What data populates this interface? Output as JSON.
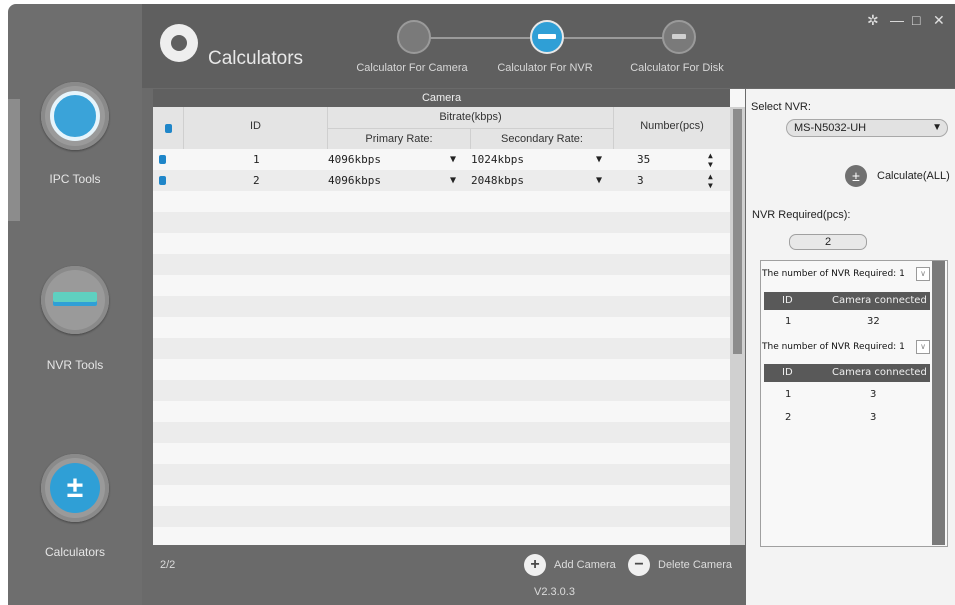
{
  "sidebar": {
    "items": [
      {
        "label": "IPC Tools",
        "icon": "ipc-camera-icon"
      },
      {
        "label": "NVR Tools",
        "icon": "nvr-device-icon"
      },
      {
        "label": "Calculators",
        "icon": "plus-minus-icon"
      }
    ]
  },
  "header": {
    "app_title": "Calculators",
    "steps": [
      {
        "label": "Calculator For Camera",
        "active": false
      },
      {
        "label": "Calculator For NVR",
        "active": true
      },
      {
        "label": "Calculator For Disk",
        "active": false
      }
    ],
    "window_controls": [
      "settings-icon",
      "minimize-icon",
      "maximize-icon",
      "close-icon"
    ]
  },
  "table": {
    "group_header": "Camera",
    "col_id": "ID",
    "col_bitrate": "Bitrate(kbps)",
    "col_primary": "Primary Rate:",
    "col_secondary": "Secondary Rate:",
    "col_number": "Number(pcs)",
    "rows": [
      {
        "id": "1",
        "primary": "4096kbps",
        "secondary": "1024kbps",
        "number": "35"
      },
      {
        "id": "2",
        "primary": "4096kbps",
        "secondary": "2048kbps",
        "number": "3"
      }
    ]
  },
  "footer": {
    "count": "2/2",
    "add_label": "Add Camera",
    "delete_label": "Delete Camera",
    "version": "V2.3.0.3"
  },
  "right_panel": {
    "select_label": "Select NVR:",
    "selected_nvr": "MS-N5032-UH",
    "calc_label": "Calculate(ALL)",
    "required_label": "NVR Required(pcs):",
    "required_value": "2",
    "results": [
      {
        "title": "The number of NVR Required: 1",
        "col_id": "ID",
        "col_camera": "Camera connected",
        "rows": [
          {
            "id": "1",
            "camera": "32"
          }
        ]
      },
      {
        "title": "The number of NVR Required: 1",
        "col_id": "ID",
        "col_camera": "Camera connected",
        "rows": [
          {
            "id": "1",
            "camera": "3"
          },
          {
            "id": "2",
            "camera": "3"
          }
        ]
      }
    ]
  },
  "colors": {
    "accent": "#2f9fd6",
    "sidebar": "#6e6e6e",
    "header": "#5f5f5f"
  }
}
